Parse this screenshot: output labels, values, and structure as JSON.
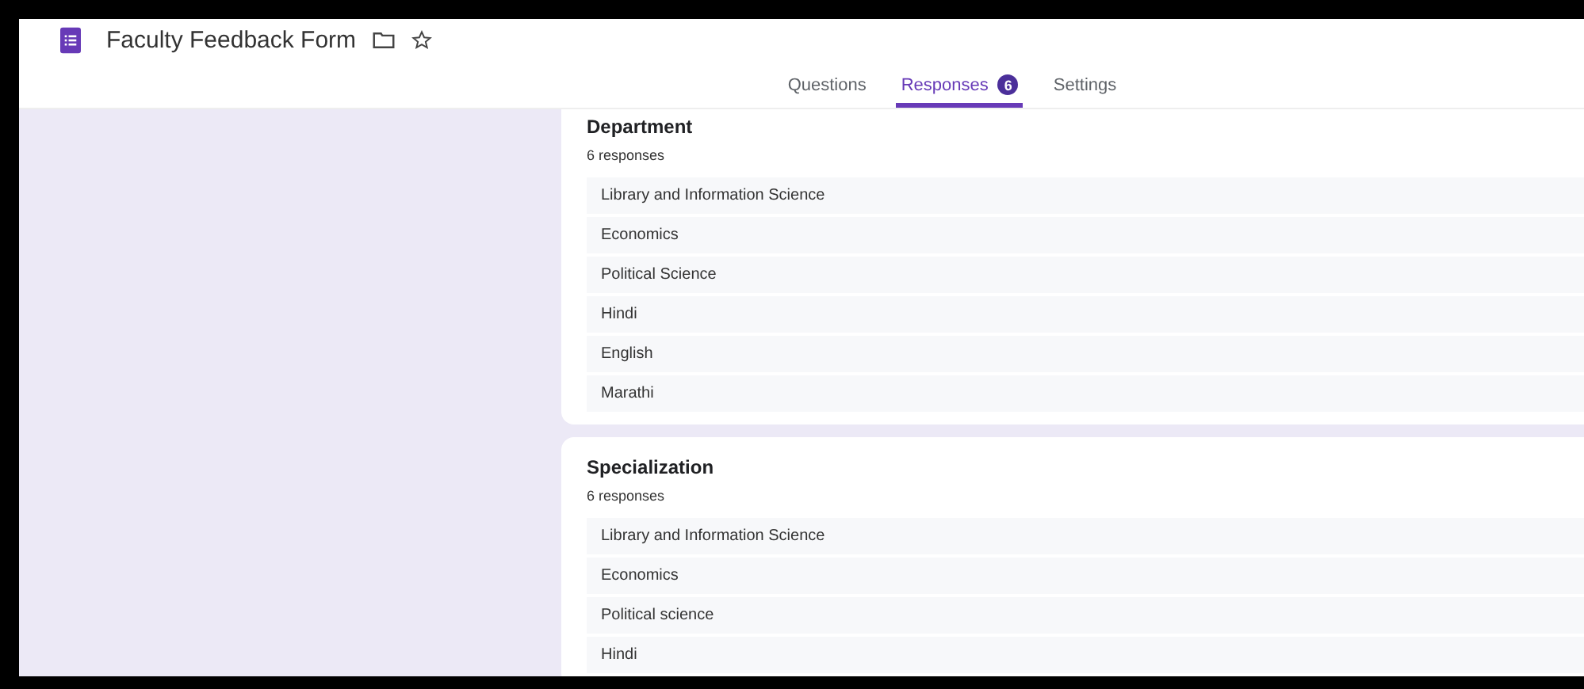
{
  "header": {
    "title": "Faculty Feedback Form"
  },
  "tabs": [
    {
      "label": "Questions",
      "selected": false
    },
    {
      "label": "Responses",
      "selected": true,
      "count": "6"
    },
    {
      "label": "Settings",
      "selected": false
    }
  ],
  "questions": [
    {
      "title": "Department",
      "summary": "6 responses",
      "answers": [
        "Library and Information Science",
        "Economics",
        "Political Science",
        "Hindi",
        "English",
        "Marathi"
      ]
    },
    {
      "title": "Specialization",
      "summary": "6 responses",
      "answers": [
        "Library and Information Science",
        "Economics",
        "Political science",
        "Hindi"
      ]
    }
  ]
}
